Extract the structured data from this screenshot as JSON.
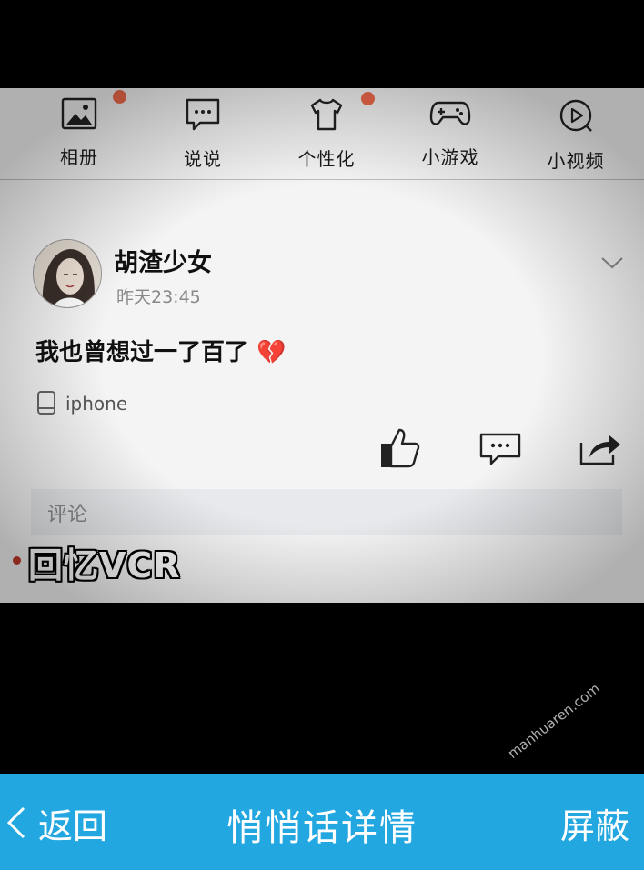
{
  "nav": {
    "items": [
      {
        "label": "相册",
        "icon": "album-icon",
        "badge": true
      },
      {
        "label": "说说",
        "icon": "chat-icon",
        "badge": false
      },
      {
        "label": "个性化",
        "icon": "tshirt-icon",
        "badge": true
      },
      {
        "label": "小游戏",
        "icon": "gamepad-icon",
        "badge": false
      },
      {
        "label": "小视频",
        "icon": "play-icon",
        "badge": false
      }
    ],
    "badge_color": "#f06a4b"
  },
  "post": {
    "author": "胡渣少女",
    "time": "昨天23:45",
    "text": "我也曾想过一了百了 💔",
    "device": "iphone"
  },
  "actions": {
    "like_icon": "thumbs-up-icon",
    "comment_icon": "comment-icon",
    "share_icon": "share-icon"
  },
  "comments": {
    "label": "评论"
  },
  "caption": "回忆VCR",
  "bottom_bar": {
    "back": "返回",
    "title": "悄悄话详情",
    "block": "屏蔽",
    "color": "#22a7e0"
  },
  "watermark": "manhuaren.com"
}
